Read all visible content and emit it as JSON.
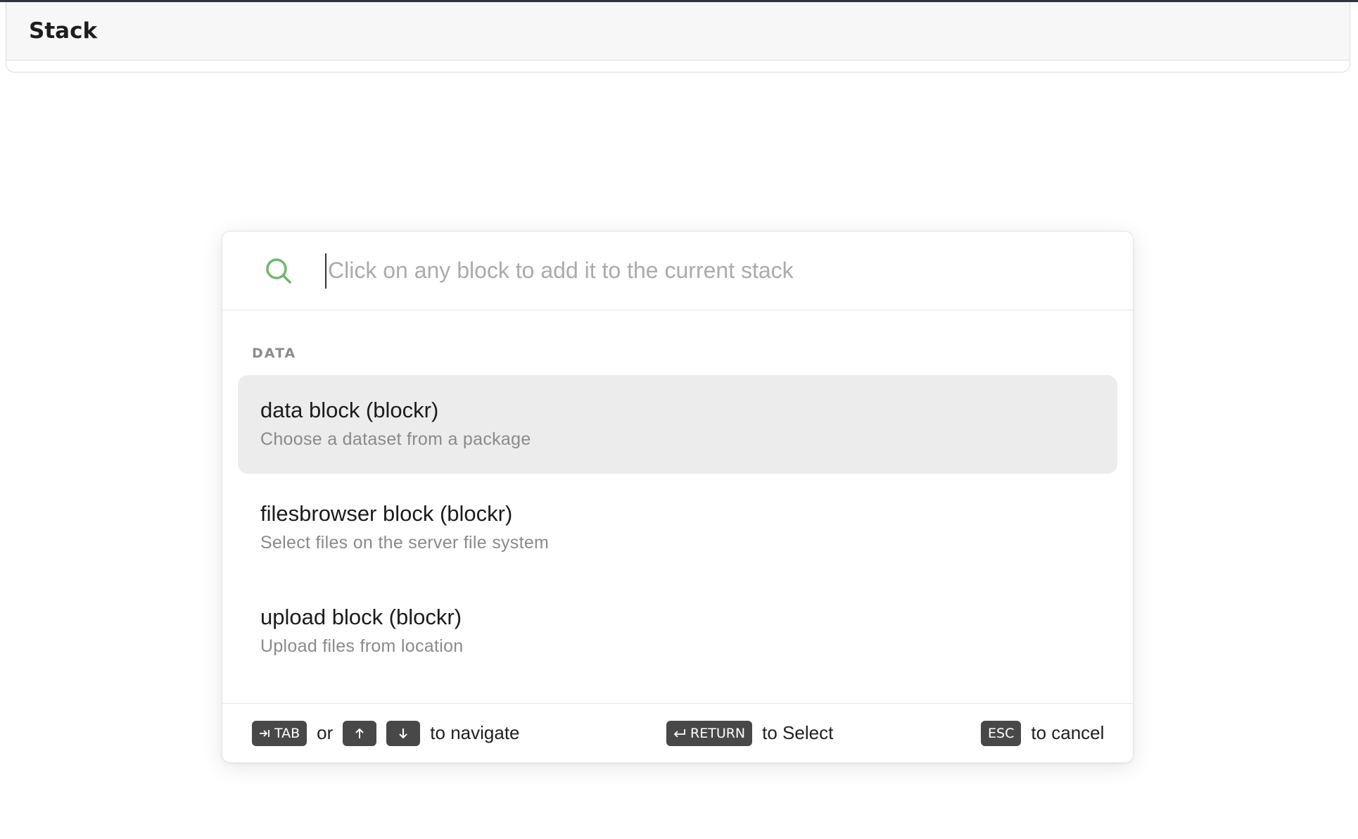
{
  "header": {
    "title": "Stack"
  },
  "search": {
    "placeholder": "Click on any block to add it to the current stack",
    "icon": "search-icon",
    "icon_color": "#6fb86b"
  },
  "group": {
    "label": "DATA"
  },
  "items": [
    {
      "title": "data block (blockr)",
      "description": "Choose a dataset from a package",
      "highlighted": true
    },
    {
      "title": "filesbrowser block (blockr)",
      "description": "Select files on the server file system",
      "highlighted": false
    },
    {
      "title": "upload block (blockr)",
      "description": "Upload files from location",
      "highlighted": false
    }
  ],
  "footer": {
    "tab_key": "TAB",
    "or_text": "or",
    "navigate_text": "to navigate",
    "return_key": "RETURN",
    "select_text": "to Select",
    "esc_key": "ESC",
    "cancel_text": "to cancel"
  },
  "colors": {
    "highlight_bg": "#ececec",
    "kbd_bg": "#484848",
    "accent": "#6fb86b"
  }
}
